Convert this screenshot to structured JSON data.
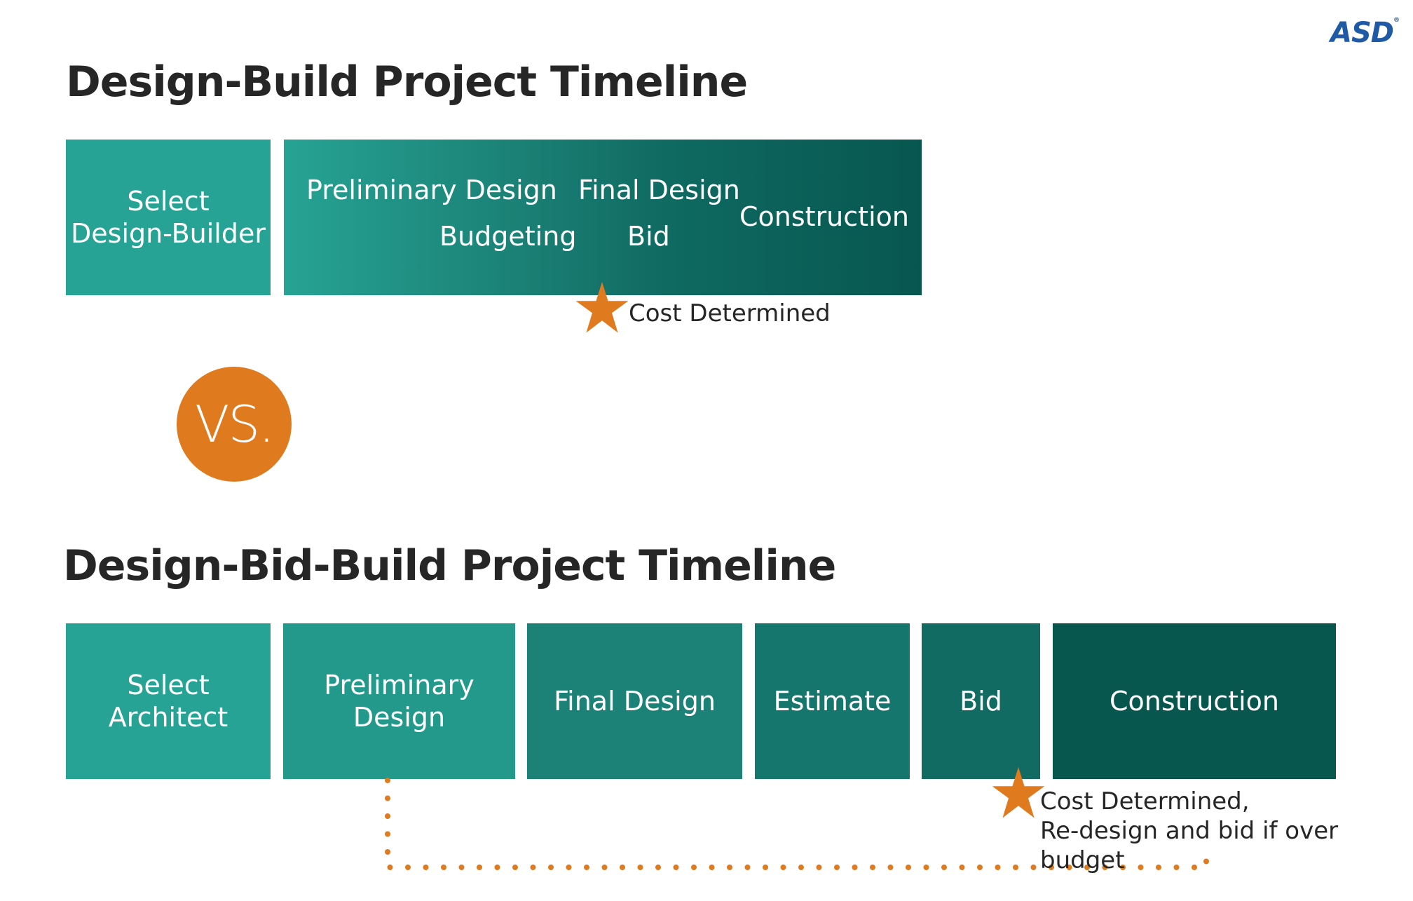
{
  "logo": {
    "text": "ASD",
    "mark": "®"
  },
  "design_build": {
    "title": "Design-Build Project Timeline",
    "select_label": "Select\nDesign-Builder",
    "phases": {
      "preliminary_design": "Preliminary Design",
      "budgeting": "Budgeting",
      "final_design": "Final Design",
      "bid": "Bid",
      "construction": "Construction"
    },
    "milestone": "Cost Determined"
  },
  "vs_label": "VS.",
  "design_bid_build": {
    "title": "Design-Bid-Build Project Timeline",
    "phases": [
      {
        "label": "Select\nArchitect"
      },
      {
        "label": "Preliminary\nDesign"
      },
      {
        "label": "Final Design"
      },
      {
        "label": "Estimate"
      },
      {
        "label": "Bid"
      },
      {
        "label": "Construction"
      }
    ],
    "milestone": "Cost Determined,\nRe-design and bid if over budget"
  },
  "colors": {
    "teal_light": "#26a394",
    "teal_mid": "#1c8277",
    "teal_dark": "#07574f",
    "orange": "#e07a1f",
    "logo_blue": "#1f5aa6"
  }
}
